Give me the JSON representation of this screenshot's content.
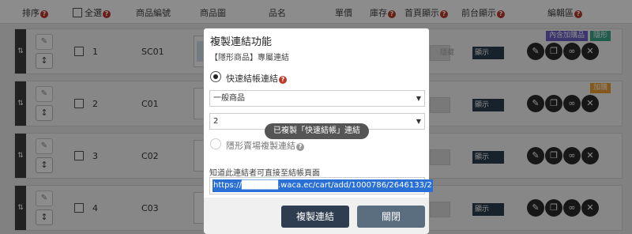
{
  "header": {
    "sort": "排序",
    "select_all": "全選",
    "code": "商品編號",
    "image": "商品圖",
    "name": "品名",
    "price": "單價",
    "stock": "庫存",
    "home_display": "首頁顯示",
    "front_display": "前台顯示",
    "edit": "編輯區"
  },
  "rows": [
    {
      "num": "1",
      "code": "SC01",
      "display": "顯示",
      "stock": "隱藏"
    },
    {
      "num": "2",
      "code": "C01",
      "display": "顯示",
      "stock": ""
    },
    {
      "num": "3",
      "code": "C02",
      "display": "顯示",
      "stock": ""
    },
    {
      "num": "4",
      "code": "C03",
      "display": "顯示",
      "stock": ""
    }
  ],
  "tags": {
    "addon_included": "內含加購品",
    "hidden": "隱形",
    "addon": "加購"
  },
  "colors": {
    "tag_purple": "#6c5fc7",
    "tag_green": "#3aa88b",
    "tag_orange": "#f0a030",
    "btn_primary": "#2e3e50",
    "btn_secondary": "#5b6e80"
  },
  "modal": {
    "title": "複製連結功能",
    "subtitle": "【隱形商品】專屬連結",
    "option_quick": "快速結帳連結",
    "select_type": "一般商品",
    "select_qty": "2",
    "toast": "已複製「快速結帳」連結",
    "option_hidden": "隱形賣場複製連結",
    "note": "知道此連結者可直接至結帳頁面",
    "link": "https://██████.waca.ec/cart/add/1000786/2646133/2",
    "copy_button": "複製連結",
    "close_button": "關閉"
  }
}
